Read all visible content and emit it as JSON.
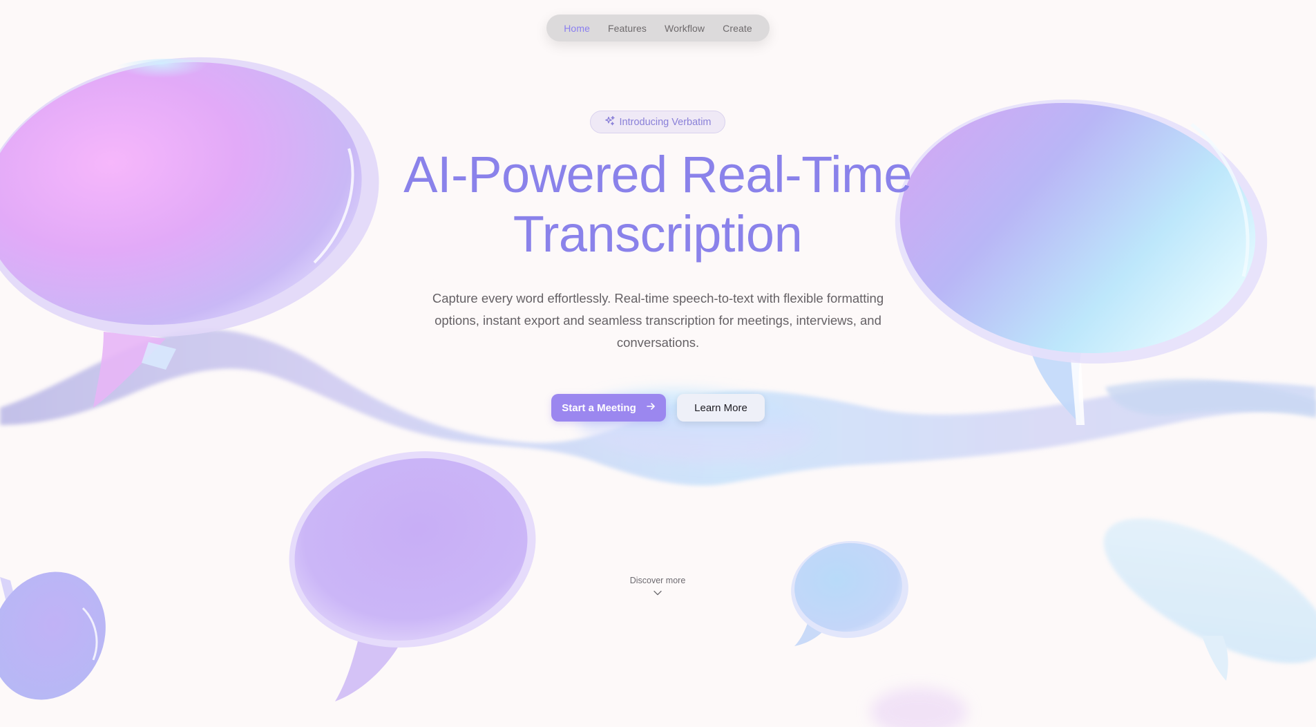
{
  "nav": {
    "items": [
      {
        "label": "Home",
        "active": true
      },
      {
        "label": "Features",
        "active": false
      },
      {
        "label": "Workflow",
        "active": false
      },
      {
        "label": "Create",
        "active": false
      }
    ]
  },
  "hero": {
    "badge": {
      "icon": "sparkles-icon",
      "label": "Introducing Verbatim"
    },
    "title_line1": "AI-Powered Real-Time",
    "title_line2": "Transcription",
    "description": "Capture every word effortlessly. Real-time speech-to-text with flexible formatting options, instant export and seamless transcription for meetings, interviews, and conversations.",
    "primary_button": {
      "label": "Start a Meeting",
      "icon": "arrow-right-icon"
    },
    "secondary_button": {
      "label": "Learn More"
    },
    "discover": {
      "label": "Discover more",
      "icon": "chevron-down-icon"
    }
  },
  "colors": {
    "background": "#fdf9f9",
    "accent": "#8a82ea",
    "primary_button": "#9b87ef",
    "nav_bg": "#dcdadb",
    "nav_active": "#8a7ff0"
  }
}
